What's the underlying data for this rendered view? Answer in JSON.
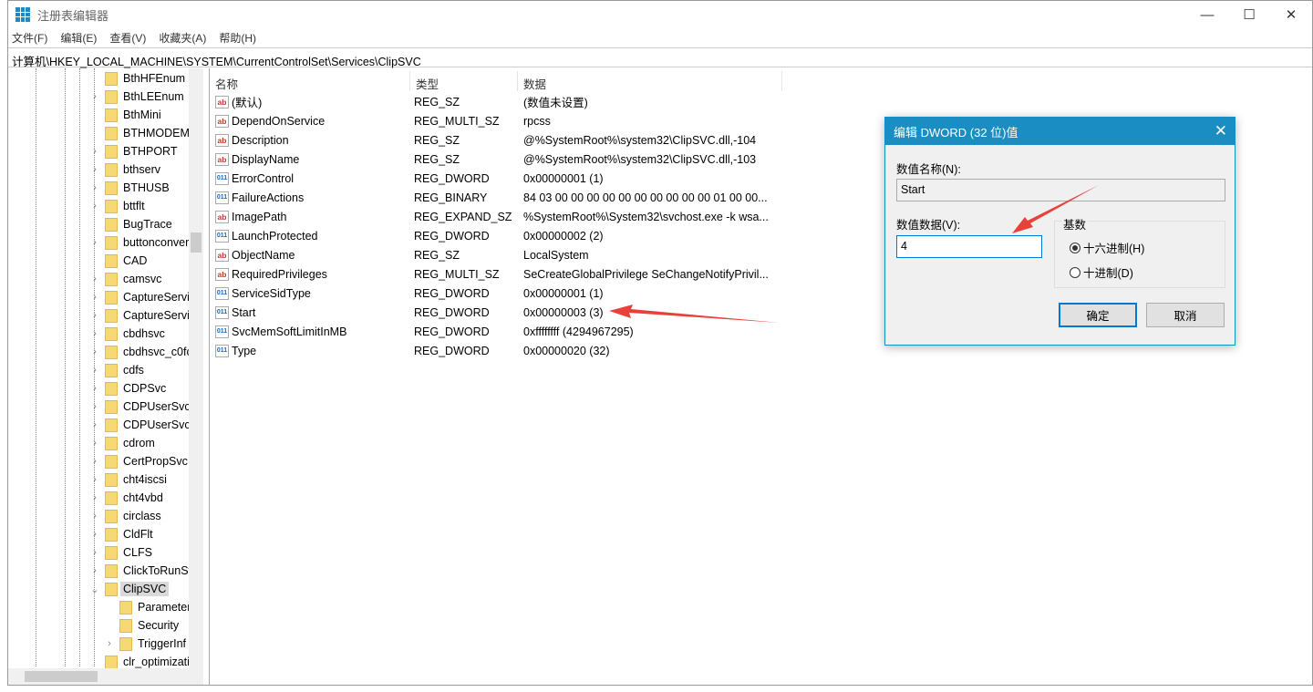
{
  "window": {
    "title": "注册表编辑器",
    "minimize": "—",
    "maximize": "☐",
    "close": "✕"
  },
  "menu": [
    "文件(F)",
    "编辑(E)",
    "查看(V)",
    "收藏夹(A)",
    "帮助(H)"
  ],
  "address": "计算机\\HKEY_LOCAL_MACHINE\\SYSTEM\\CurrentControlSet\\Services\\ClipSVC",
  "tree": [
    {
      "label": "BthHFEnum",
      "exp": ""
    },
    {
      "label": "BthLEEnum",
      "exp": ">"
    },
    {
      "label": "BthMini",
      "exp": ""
    },
    {
      "label": "BTHMODEM",
      "exp": ""
    },
    {
      "label": "BTHPORT",
      "exp": ">"
    },
    {
      "label": "bthserv",
      "exp": ">"
    },
    {
      "label": "BTHUSB",
      "exp": ">"
    },
    {
      "label": "bttflt",
      "exp": ">"
    },
    {
      "label": "BugTrace",
      "exp": ""
    },
    {
      "label": "buttonconver",
      "exp": ">"
    },
    {
      "label": "CAD",
      "exp": ""
    },
    {
      "label": "camsvc",
      "exp": ">"
    },
    {
      "label": "CaptureServi",
      "exp": ">"
    },
    {
      "label": "CaptureServi",
      "exp": ">"
    },
    {
      "label": "cbdhsvc",
      "exp": ">"
    },
    {
      "label": "cbdhsvc_c0fc",
      "exp": ">"
    },
    {
      "label": "cdfs",
      "exp": ">"
    },
    {
      "label": "CDPSvc",
      "exp": ">"
    },
    {
      "label": "CDPUserSvc",
      "exp": ">"
    },
    {
      "label": "CDPUserSvc_",
      "exp": ">"
    },
    {
      "label": "cdrom",
      "exp": ">"
    },
    {
      "label": "CertPropSvc",
      "exp": ">"
    },
    {
      "label": "cht4iscsi",
      "exp": ">"
    },
    {
      "label": "cht4vbd",
      "exp": ">"
    },
    {
      "label": "circlass",
      "exp": ">"
    },
    {
      "label": "CldFlt",
      "exp": ">"
    },
    {
      "label": "CLFS",
      "exp": ">"
    },
    {
      "label": "ClickToRunSv",
      "exp": ">"
    },
    {
      "label": "ClipSVC",
      "exp": "v",
      "selected": true
    },
    {
      "label": "Parameter",
      "exp": "",
      "child": true
    },
    {
      "label": "Security",
      "exp": "",
      "child": true
    },
    {
      "label": "TriggerInf",
      "exp": ">",
      "child": true
    },
    {
      "label": "clr_optimizati",
      "exp": ""
    }
  ],
  "columns": [
    "名称",
    "类型",
    "数据"
  ],
  "values": [
    {
      "name": "(默认)",
      "type": "REG_SZ",
      "data": "(数值未设置)",
      "icon": "string"
    },
    {
      "name": "DependOnService",
      "type": "REG_MULTI_SZ",
      "data": "rpcss",
      "icon": "string"
    },
    {
      "name": "Description",
      "type": "REG_SZ",
      "data": "@%SystemRoot%\\system32\\ClipSVC.dll,-104",
      "icon": "string"
    },
    {
      "name": "DisplayName",
      "type": "REG_SZ",
      "data": "@%SystemRoot%\\system32\\ClipSVC.dll,-103",
      "icon": "string"
    },
    {
      "name": "ErrorControl",
      "type": "REG_DWORD",
      "data": "0x00000001 (1)",
      "icon": "binary"
    },
    {
      "name": "FailureActions",
      "type": "REG_BINARY",
      "data": "84 03 00 00 00 00 00 00 00 00 00 00 01 00 00...",
      "icon": "binary"
    },
    {
      "name": "ImagePath",
      "type": "REG_EXPAND_SZ",
      "data": "%SystemRoot%\\System32\\svchost.exe -k wsa...",
      "icon": "string"
    },
    {
      "name": "LaunchProtected",
      "type": "REG_DWORD",
      "data": "0x00000002 (2)",
      "icon": "binary"
    },
    {
      "name": "ObjectName",
      "type": "REG_SZ",
      "data": "LocalSystem",
      "icon": "string"
    },
    {
      "name": "RequiredPrivileges",
      "type": "REG_MULTI_SZ",
      "data": "SeCreateGlobalPrivilege SeChangeNotifyPrivil...",
      "icon": "string"
    },
    {
      "name": "ServiceSidType",
      "type": "REG_DWORD",
      "data": "0x00000001 (1)",
      "icon": "binary"
    },
    {
      "name": "Start",
      "type": "REG_DWORD",
      "data": "0x00000003 (3)",
      "icon": "binary"
    },
    {
      "name": "SvcMemSoftLimitInMB",
      "type": "REG_DWORD",
      "data": "0xffffffff (4294967295)",
      "icon": "binary"
    },
    {
      "name": "Type",
      "type": "REG_DWORD",
      "data": "0x00000020 (32)",
      "icon": "binary"
    }
  ],
  "dialog": {
    "title": "编辑 DWORD (32 位)值",
    "name_label": "数值名称(N):",
    "name_value": "Start",
    "data_label": "数值数据(V):",
    "data_value": "4",
    "base_label": "基数",
    "hex": "十六进制(H)",
    "dec": "十进制(D)",
    "hex_selected": true,
    "ok": "确定",
    "cancel": "取消",
    "close": "✕"
  },
  "colors": {
    "dialog_title": "#1a8dc2",
    "annotation_arrow": "#e8413a",
    "folder": "#f8d775"
  }
}
